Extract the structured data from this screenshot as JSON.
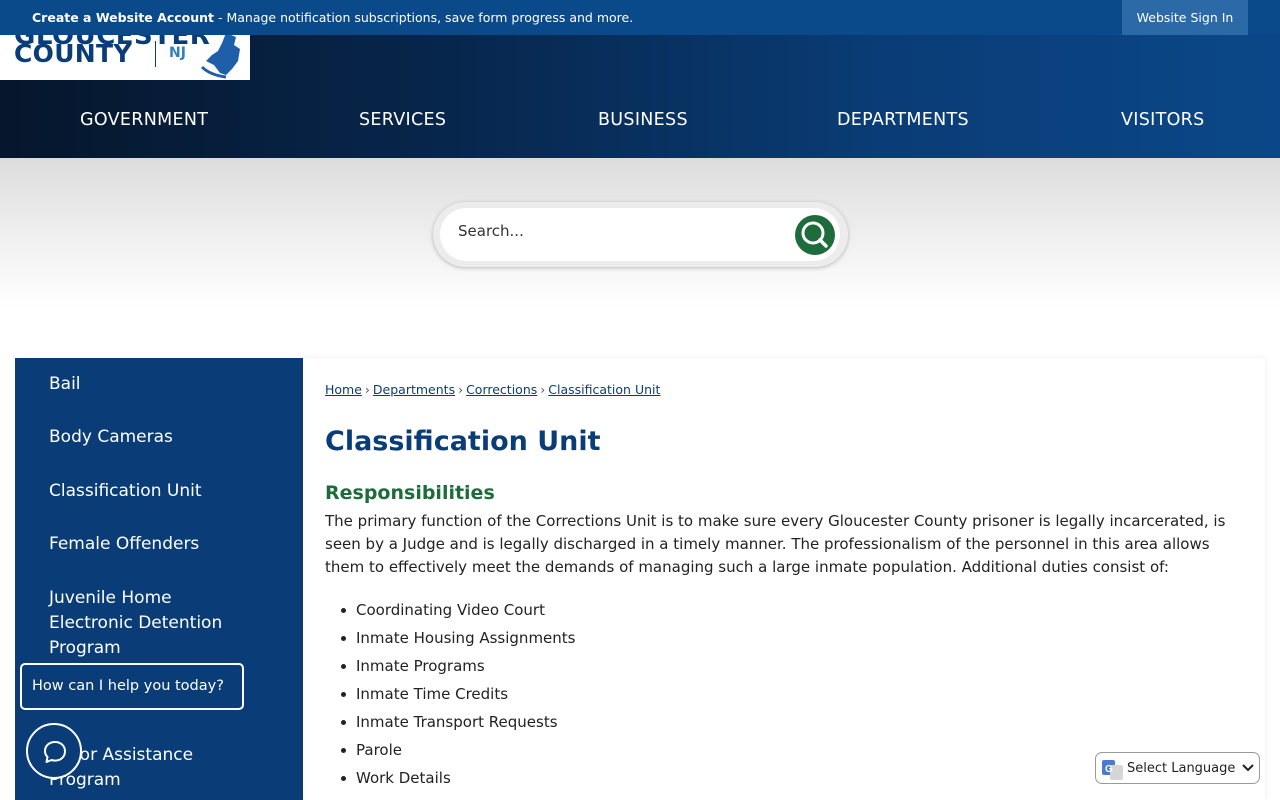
{
  "topbar": {
    "account_bold": "Create a Website Account",
    "account_rest": " - Manage notification subscriptions, save form progress and more.",
    "signin_label": "Website Sign In"
  },
  "logo": {
    "top_word": "GLOUCESTER",
    "county": "COUNTY",
    "state_abbr": "NJ"
  },
  "nav": {
    "items": [
      "GOVERNMENT",
      "SERVICES",
      "BUSINESS",
      "DEPARTMENTS",
      "VISITORS"
    ]
  },
  "search": {
    "placeholder": "Search...",
    "icon": "search-icon"
  },
  "sidebar": {
    "items": [
      "Bail",
      "Body Cameras",
      "Classification Unit",
      "Female Offenders",
      "Juvenile Home Electronic Detention Program",
      "Labor Assistance Program"
    ]
  },
  "breadcrumb": {
    "items": [
      "Home",
      "Departments",
      "Corrections",
      "Classification Unit"
    ],
    "separator": "›"
  },
  "main": {
    "title": "Classification Unit",
    "subtitle": "Responsibilities",
    "paragraph": "The primary function of the Corrections Unit is to make sure every Gloucester County prisoner is legally incarcerated, is seen by a Judge and is legally discharged in a timely manner. The professionalism of the personnel in this area allows them to effectively meet the demands of managing such a large inmate population. Additional duties consist of:",
    "duties": [
      "Coordinating Video Court",
      "Inmate Housing Assignments",
      "Inmate Programs",
      "Inmate Time Credits",
      "Inmate Transport Requests",
      "Parole",
      "Work Details"
    ]
  },
  "chat": {
    "prompt": "How can I help you today?",
    "icon": "chat-icon"
  },
  "translate": {
    "label": "Select Language",
    "icon": "google-translate-icon"
  },
  "colors": {
    "brand_blue": "#0a3d77",
    "topbar_blue": "#0a4a8a",
    "accent_green": "#1e6b3c"
  }
}
